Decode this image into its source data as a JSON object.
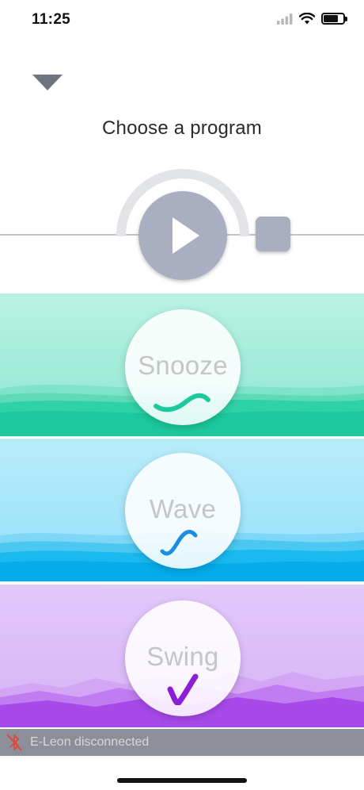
{
  "status_bar": {
    "time": "11:25",
    "icons": [
      "signal-icon",
      "wifi-icon",
      "battery-icon"
    ]
  },
  "header": {
    "title": "Choose a program",
    "collapse_icon": "triangle-down-icon"
  },
  "player": {
    "play_icon": "play-icon",
    "stop_icon": "stop-icon",
    "color": "#a9aec0"
  },
  "programs": [
    {
      "name": "Snooze",
      "icon": "snooze-wave-icon",
      "accent": "#1fc9a0"
    },
    {
      "name": "Wave",
      "icon": "wave-curve-icon",
      "accent": "#1c8ee0"
    },
    {
      "name": "Swing",
      "icon": "swing-check-icon",
      "accent": "#8a1fd6"
    }
  ],
  "connection": {
    "message": "E-Leon disconnected",
    "icon": "bluetooth-disabled-icon",
    "icon_color": "#d94a40"
  }
}
